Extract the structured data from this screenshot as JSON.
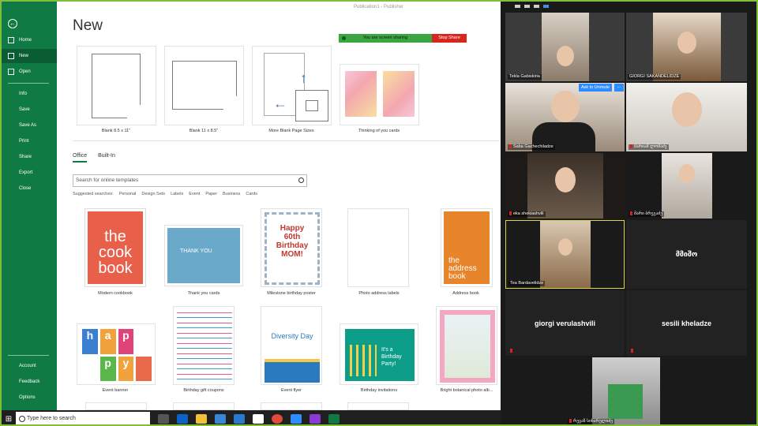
{
  "window_title": "Publication1 - Publisher",
  "page_title": "New",
  "screen_share": {
    "status": "You are screen sharing",
    "stop_label": "Stop Share"
  },
  "nav": {
    "back": "←",
    "top_items": [
      "Home",
      "New",
      "Open"
    ],
    "middle_items": [
      "Info",
      "Save",
      "Save As",
      "Print",
      "Share",
      "Export",
      "Close"
    ],
    "bottom_items": [
      "Account",
      "Feedback",
      "Options"
    ],
    "active": "New"
  },
  "blank_templates": [
    {
      "label": "Blank 8.5 x 11\""
    },
    {
      "label": "Blank 11 x 8.5\""
    },
    {
      "label": "More Blank Page Sizes"
    },
    {
      "label": "Thinking of you cards"
    }
  ],
  "tabs": [
    "Office",
    "Built-In"
  ],
  "search": {
    "placeholder": "Search for online templates"
  },
  "suggested": {
    "label": "Suggested searches:",
    "items": [
      "Personal",
      "Design Sets",
      "Labels",
      "Event",
      "Paper",
      "Business",
      "Cards"
    ]
  },
  "templates_row1": [
    {
      "label": "Modern cookbook",
      "art": "the cook book"
    },
    {
      "label": "Thank you cards",
      "art": "THANK YOU"
    },
    {
      "label": "Milestone birthday poster",
      "art": "Happy 60th Birthday MOM!"
    },
    {
      "label": "Photo address labels",
      "art": ""
    },
    {
      "label": "Address book",
      "art": "the address book"
    }
  ],
  "templates_row2": [
    {
      "label": "Event banner",
      "art": "hap py"
    },
    {
      "label": "Birthday gift coupons",
      "art": ""
    },
    {
      "label": "Event flyer",
      "art": "Diversity Day"
    },
    {
      "label": "Birthday invitations",
      "art": "It's a Birthday Party!"
    },
    {
      "label": "Bright botanical photo alb...",
      "art": ""
    }
  ],
  "taskbar": {
    "search_placeholder": "Type here to search"
  },
  "zoom": {
    "unmute_label": "Ask to Unmute",
    "more_label": "...",
    "participants": [
      {
        "name": "Tekla Gabiskiria",
        "video": true
      },
      {
        "name": "GIORGI SAKANDELIDZE",
        "video": true
      },
      {
        "name": "Saba Gachechiladze",
        "video": true
      },
      {
        "name": "მარიამ ლომაძე",
        "video": true
      },
      {
        "name": "eka shekiashvili",
        "video": true
      },
      {
        "name": "მარი ბრეგაძე",
        "video": true
      },
      {
        "name": "Tea Bardavelidze",
        "video": true
      },
      {
        "name": "მმიშო",
        "video": false
      },
      {
        "name": "giorgi verulashvili",
        "video": false
      },
      {
        "name": "sesili kheladze",
        "video": false
      },
      {
        "name": "რევაზ სიხარულიძე",
        "video": true
      }
    ]
  }
}
